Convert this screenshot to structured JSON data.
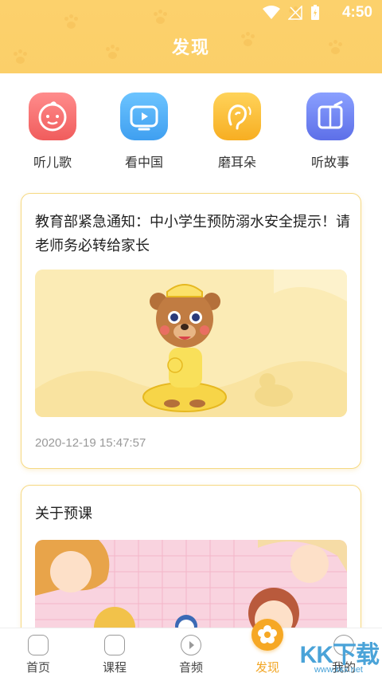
{
  "status_bar": {
    "time": "4:50"
  },
  "header": {
    "title": "发现"
  },
  "categories": [
    {
      "label": "听儿歌",
      "icon": "baby-face-icon",
      "color": "#f46f6f"
    },
    {
      "label": "看中国",
      "icon": "tv-play-icon",
      "color": "#4aaef2"
    },
    {
      "label": "磨耳朵",
      "icon": "ear-icon",
      "color": "#f9b82d"
    },
    {
      "label": "听故事",
      "icon": "book-icon",
      "color": "#6a7ef0"
    }
  ],
  "cards": [
    {
      "title": "教育部紧急通知：中小学生预防溺水安全提示！请老师务必转给家长",
      "time": "2020-12-19 15:47:57",
      "image": "bear-with-swim-ring"
    },
    {
      "title": "关于预课",
      "image": "children-illustration"
    }
  ],
  "bottom_nav": [
    {
      "label": "首页",
      "icon": "home-icon"
    },
    {
      "label": "课程",
      "icon": "course-icon"
    },
    {
      "label": "音频",
      "icon": "audio-play-icon"
    },
    {
      "label": "发现",
      "icon": "discover-flower-icon",
      "active": true
    },
    {
      "label": "我的",
      "icon": "bear-profile-icon"
    }
  ],
  "watermark": {
    "text": "KK下载",
    "sub": "www.kkx.net"
  },
  "colors": {
    "header": "#fbcf69",
    "accent": "#f6a825",
    "card_border": "#f6d982"
  }
}
